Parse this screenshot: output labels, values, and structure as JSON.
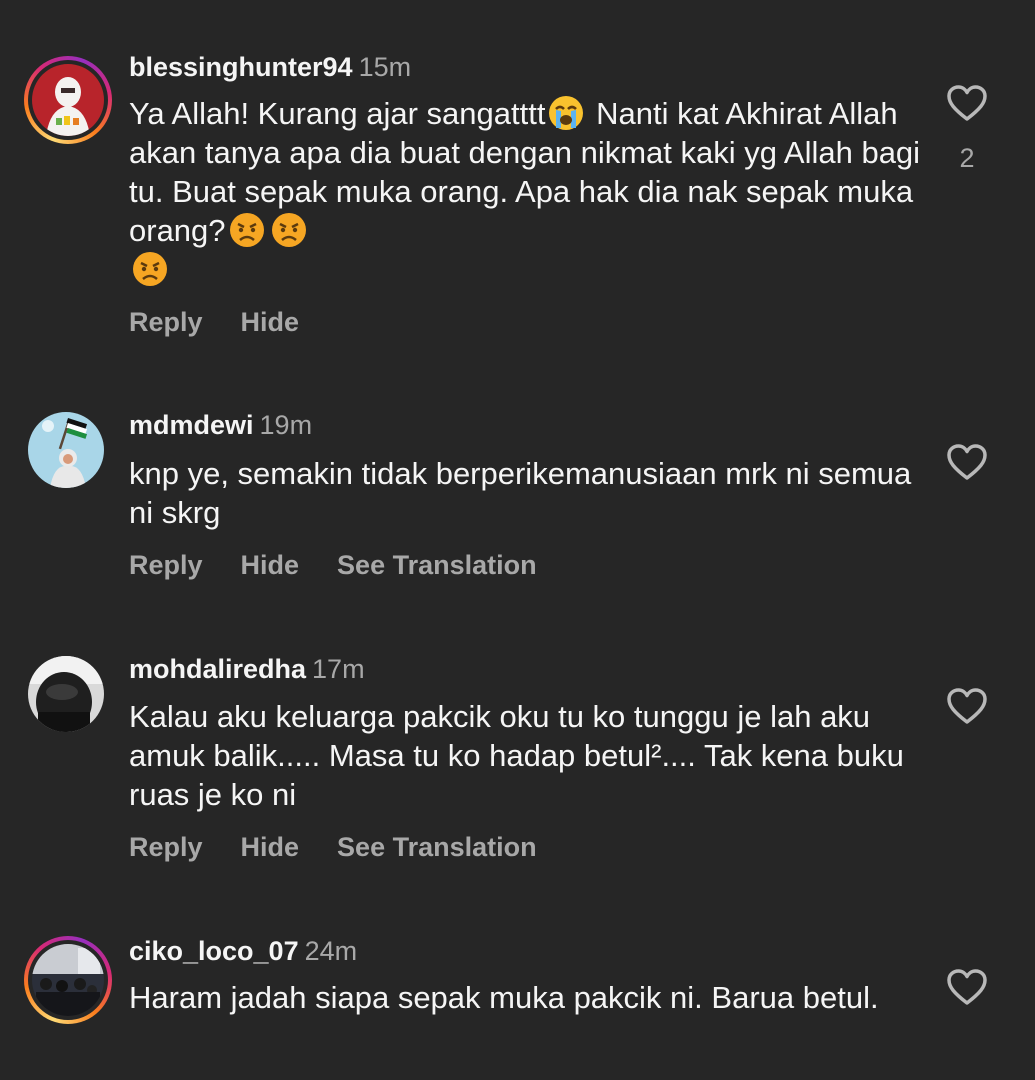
{
  "comments": [
    {
      "username": "blessinghunter94",
      "time": "15m",
      "text_parts": [
        "Ya Allah! Kurang ajar sangatttt",
        " Nanti kat Akhirat Allah akan tanya apa dia buat dengan nikmat kaki yg Allah bagi tu. Buat sepak muka orang. Apa hak dia nak sepak muka orang?"
      ],
      "emojis": [
        "loudly-crying-face-emoji",
        "angry-face-emoji",
        "angry-face-emoji",
        "angry-face-emoji"
      ],
      "likes": "2",
      "actions": [
        "Reply",
        "Hide"
      ]
    },
    {
      "username": "mdmdewi",
      "time": "19m",
      "text": "knp ye, semakin tidak berperikemanusiaan mrk ni semua ni skrg",
      "actions": [
        "Reply",
        "Hide",
        "See Translation"
      ]
    },
    {
      "username": "mohdaliredha",
      "time": "17m",
      "text": "Kalau aku keluarga pakcik oku tu ko tunggu je lah aku amuk balik..... Masa tu ko hadap betul².... Tak kena buku ruas je ko ni",
      "actions": [
        "Reply",
        "Hide",
        "See Translation"
      ]
    },
    {
      "username": "ciko_loco_07",
      "time": "24m",
      "text": "Haram jadah siapa sepak muka pakcik ni. Barua betul."
    }
  ],
  "colors": {
    "background": "#262626",
    "primary_text": "#f5f5f5",
    "secondary_text": "#a8a8a8"
  },
  "icons": [
    "heart-outline-icon"
  ]
}
